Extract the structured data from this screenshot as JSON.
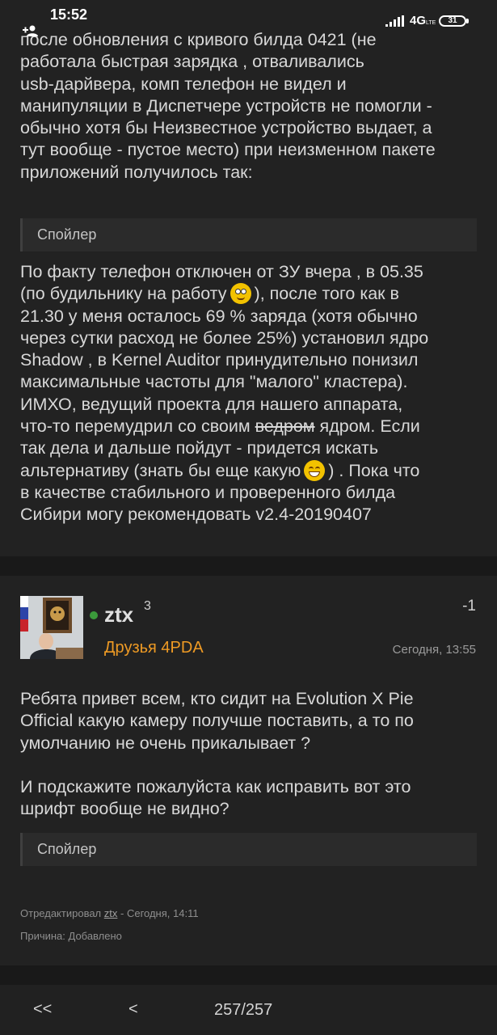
{
  "status_bar": {
    "time": "15:52",
    "network": "4G",
    "network_sub": "LTE",
    "battery": "31"
  },
  "post_top": {
    "lines_1": [
      "после обновления с кривого билда 0421 (не",
      "работала быстрая зарядка , отваливались",
      "usb-дарйвера, комп телефон не видел и",
      "манипуляции в Диспетчере устройств не помогли -",
      "обычно хотя бы Неизвестное устройство выдает, а",
      "тут вообще - пустое место) при неизменном пакете",
      "приложений получилось так:"
    ],
    "spoiler_label": "Спойлер",
    "p2_line1": "По факту телефон отключен от ЗУ вчера , в 05.35",
    "p2_line2a": "(по будильнику на работу",
    "p2_line2b": "), после того как в",
    "p2_lines_mid": [
      "21.30 у меня осталось 69 % заряда (хотя обычно",
      "через сутки расход не более 25%) установил ядро",
      "Shadow , в Kernel Auditor  принудительно понизил",
      "максимальные частоты для \"малого\" кластера).",
      "ИМХО, ведущий проекта для нашего аппарата,"
    ],
    "p2_line8a": "что-то перемудрил со своим",
    "p2_line8_strike": "ведром",
    "p2_line8b": "ядром. Если",
    "p2_line9": "так дела и дальше пойдут - придется искать",
    "p2_line10a": "альтернативу (знать бы еще какую",
    "p2_line10b": ") . Пока что",
    "p2_lines_end": [
      "в качестве стабильного и проверенного билда",
      "Сибири могу рекомендовать v2.4-20190407"
    ]
  },
  "post_bottom": {
    "username": "ztx",
    "reputation": "3",
    "group": "Друзья 4PDA",
    "score": "-1",
    "time": "Сегодня, 13:55",
    "lines_1": [
      "Ребята привет всем, кто сидит на Evolution X Pie",
      "Official какую камеру получше поставить, а то по",
      "умолчанию не очень прикалывает ?"
    ],
    "lines_2": [
      "И подскажите пожалуйста как исправить вот это",
      "шрифт вообще не видно?"
    ],
    "spoiler_label": "Спойлер",
    "edited_prefix": "Отредактировал",
    "edited_user": "ztx",
    "edited_suffix": "- Сегодня, 14:11",
    "reason": "Причина: Добавлено"
  },
  "pagination": {
    "first": "<<",
    "prev": "<",
    "pages": "257/257"
  },
  "colors": {
    "background": "#1a1a1a",
    "post_bg": "#222222",
    "group_color": "#ee9a24",
    "online": "#3b9a3b"
  }
}
